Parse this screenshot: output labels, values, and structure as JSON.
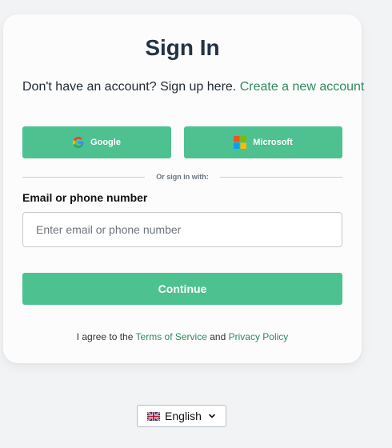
{
  "signin": {
    "title": "Sign In",
    "signup_prompt": "Don't have an account? Sign up here.",
    "signup_link": "Create a new account",
    "google_label": "Google",
    "microsoft_label": "Microsoft",
    "divider_text": "Or sign in with:",
    "field_label": "Email or phone number",
    "field_value": "",
    "field_placeholder": "Enter email or phone number",
    "continue_label": "Continue",
    "terms_prefix": "I agree to the",
    "terms_link": "Terms of Service",
    "terms_and": "and",
    "privacy_link": "Privacy Policy"
  },
  "language": {
    "flag_icon": "uk-flag-icon",
    "selected": "English",
    "chevron_icon": "chevron-down-icon"
  },
  "colors": {
    "accent": "#4ec191",
    "link": "#2e8a5f",
    "title": "#243342",
    "background": "#f2f3f5",
    "card": "#fcfcfd"
  }
}
